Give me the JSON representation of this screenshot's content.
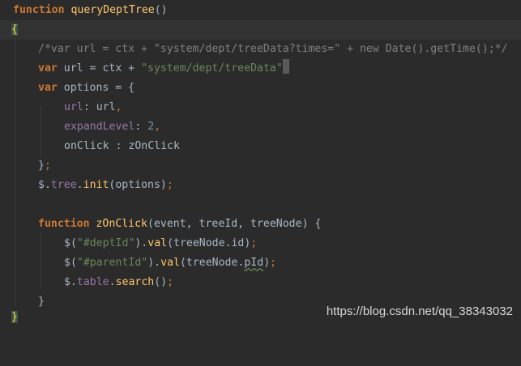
{
  "editor": {
    "lines": [
      {
        "function_kw": "function",
        "fn_name": "queryDeptTree",
        "parens": "()"
      },
      {
        "brace": "{"
      },
      {
        "comment": "/*var url = ctx + \"system/dept/treeData?times=\" + new Date().getTime();*/"
      },
      {
        "kw": "var",
        "name": "url",
        "eq": " = ",
        "ctx": "ctx",
        "plus": " + ",
        "str": "\"system/dept/treeData\""
      },
      {
        "kw": "var",
        "name": "options",
        "rest": " = {"
      },
      {
        "prop": "url",
        "colon": ": ",
        "val": "url",
        "comma": ","
      },
      {
        "prop": "expandLevel",
        "colon": ": ",
        "num": "2",
        "comma": ","
      },
      {
        "text": "onClick : zOnClick"
      },
      {
        "close": "}",
        "semi": ";"
      },
      {
        "dollar": "$",
        "dot1": ".",
        "tree": "tree",
        "dot2": ".",
        "init": "init",
        "args": "(options)",
        "semi": ";"
      },
      {
        "function_kw": "function",
        "fn_name": "zOnClick",
        "params": "(event, treeId, treeNode) {"
      },
      {
        "call": "$(",
        "str": "\"#deptId\"",
        "mid": ").",
        "fn": "val",
        "args": "(treeNode.id)",
        "semi": ";"
      },
      {
        "call": "$(",
        "str": "\"#parentId\"",
        "mid": ").",
        "fn": "val",
        "args_a": "(treeNode.",
        "args_b": "pId",
        "args_c": ")",
        "semi": ";"
      },
      {
        "dollar": "$",
        "dot1": ".",
        "table": "table",
        "dot2": ".",
        "fn": "search",
        "args": "()",
        "semi": ";"
      },
      {
        "close": "}"
      },
      {
        "brace": "}"
      }
    ]
  },
  "watermark": "https://blog.csdn.net/qq_38343032"
}
